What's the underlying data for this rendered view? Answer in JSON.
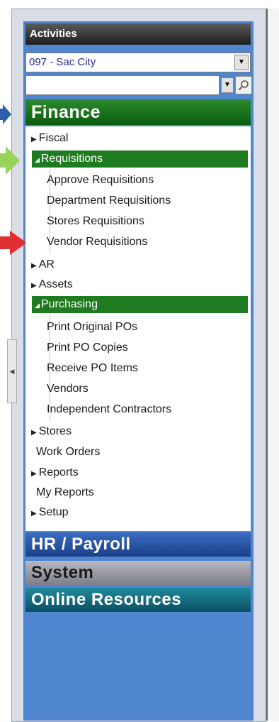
{
  "activities": {
    "title": "Activities",
    "college_select": "097 - Sac City",
    "search_value": ""
  },
  "finance": {
    "title": "Finance",
    "items": {
      "fiscal": "Fiscal",
      "requisitions": "Requisitions",
      "req_children": [
        "Approve Requisitions",
        "Department Requisitions",
        "Stores Requisitions",
        "Vendor Requisitions"
      ],
      "ar": "AR",
      "assets": "Assets",
      "purchasing": "Purchasing",
      "pur_children": [
        "Print Original POs",
        "Print PO Copies",
        "Receive PO Items",
        "Vendors",
        "Independent Contractors"
      ],
      "stores": "Stores",
      "work_orders": "Work Orders",
      "reports": "Reports",
      "my_reports": "My Reports",
      "setup": "Setup"
    }
  },
  "sections": {
    "hr": "HR / Payroll",
    "system": "System",
    "online": "Online Resources"
  },
  "colors": {
    "finance": "#1f7b1f",
    "hr": "#2a56a8",
    "system": "#9a9aa4",
    "online": "#156f80",
    "sidebar_bg": "#4f86cf"
  },
  "icons": {
    "collapsed": "triangle-right",
    "expanded": "triangle-down",
    "search": "magnifier"
  }
}
